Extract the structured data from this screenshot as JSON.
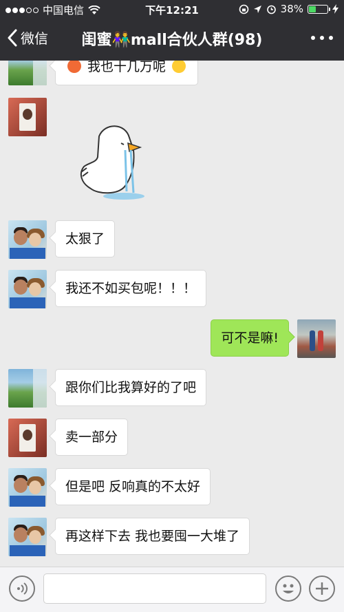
{
  "status": {
    "carrier": "中国电信",
    "time": "下午12:21",
    "battery": "38%",
    "battery_level": 0.38
  },
  "nav": {
    "back_label": "微信",
    "title": "闺蜜👫mall合伙人群(98)"
  },
  "messages": [
    {
      "side": "left",
      "avatar": "landscape",
      "text": "我也十几万呢"
    },
    {
      "side": "left",
      "avatar": "phone-girl",
      "sticker": "crying-duck-sticker"
    },
    {
      "side": "left",
      "avatar": "couple",
      "text": "太狠了"
    },
    {
      "side": "left",
      "avatar": "couple",
      "text": "我还不如买包呢！！！"
    },
    {
      "side": "right",
      "avatar": "street-couple",
      "text": "可不是嘛!"
    },
    {
      "side": "left",
      "avatar": "landscape",
      "text": "跟你们比我算好的了吧"
    },
    {
      "side": "left",
      "avatar": "phone-girl",
      "text": "卖一部分"
    },
    {
      "side": "left",
      "avatar": "couple",
      "text": "但是吧 反响真的不太好"
    },
    {
      "side": "left",
      "avatar": "couple",
      "text": "再这样下去 我也要囤一大堆了"
    }
  ],
  "colors": {
    "nav_bg": "#2f2f33",
    "chat_bg": "#ebebeb",
    "mine_bubble": "#9fe658",
    "other_bubble": "#ffffff"
  },
  "icons": {
    "voice": "voice-icon",
    "emoji": "emoji-icon",
    "plus": "plus-icon",
    "more": "more-dots-icon",
    "back": "chevron-left-icon"
  }
}
